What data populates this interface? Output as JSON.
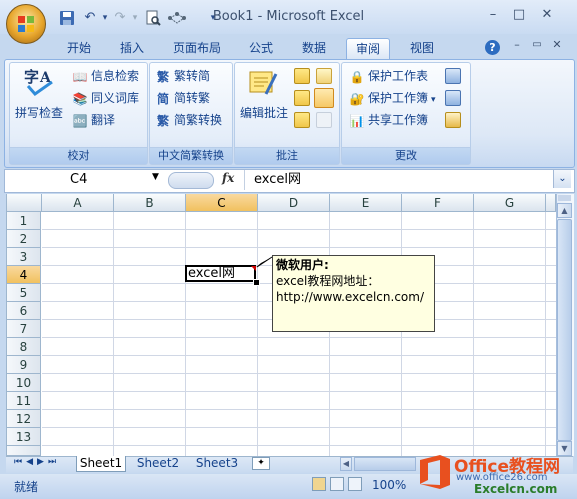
{
  "window": {
    "title": "Book1 - Microsoft Excel"
  },
  "tabs": [
    {
      "label": "开始"
    },
    {
      "label": "插入"
    },
    {
      "label": "页面布局"
    },
    {
      "label": "公式"
    },
    {
      "label": "数据"
    },
    {
      "label": "审阅"
    },
    {
      "label": "视图"
    }
  ],
  "active_tab": "审阅",
  "ribbon": {
    "proofing": {
      "label": "校对",
      "spellcheck": "拼写检查",
      "research": "信息检索",
      "thesaurus": "同义词库",
      "translate": "翻译"
    },
    "chinese": {
      "label": "中文简繁转换",
      "to_simplified": "繁转简",
      "to_traditional": "简转繁",
      "convert": "简繁转换"
    },
    "comments": {
      "label": "批注",
      "edit_comment": "编辑批注"
    },
    "changes": {
      "label": "更改",
      "protect_sheet": "保护工作表",
      "protect_workbook": "保护工作簿",
      "share_workbook": "共享工作簿"
    }
  },
  "formula_bar": {
    "name_box": "C4",
    "fx": "fx",
    "formula": "excel网"
  },
  "columns": [
    "A",
    "B",
    "C",
    "D",
    "E",
    "F",
    "G"
  ],
  "rows": [
    "1",
    "2",
    "3",
    "4",
    "5",
    "6",
    "7",
    "8",
    "9",
    "10",
    "11",
    "12",
    "13"
  ],
  "selected_cell": {
    "ref": "C4",
    "value": "excel网"
  },
  "comment": {
    "author": "微软用户:",
    "line1": "excel教程网地址：",
    "line2": "http://www.excelcn.com/"
  },
  "sheets": [
    "Sheet1",
    "Sheet2",
    "Sheet3"
  ],
  "active_sheet": "Sheet1",
  "status": {
    "text": "就绪",
    "zoom": "100%"
  },
  "brand": {
    "line1": "Office教程网",
    "line2": "www.office26.com",
    "line3": "Excelcn.com"
  }
}
